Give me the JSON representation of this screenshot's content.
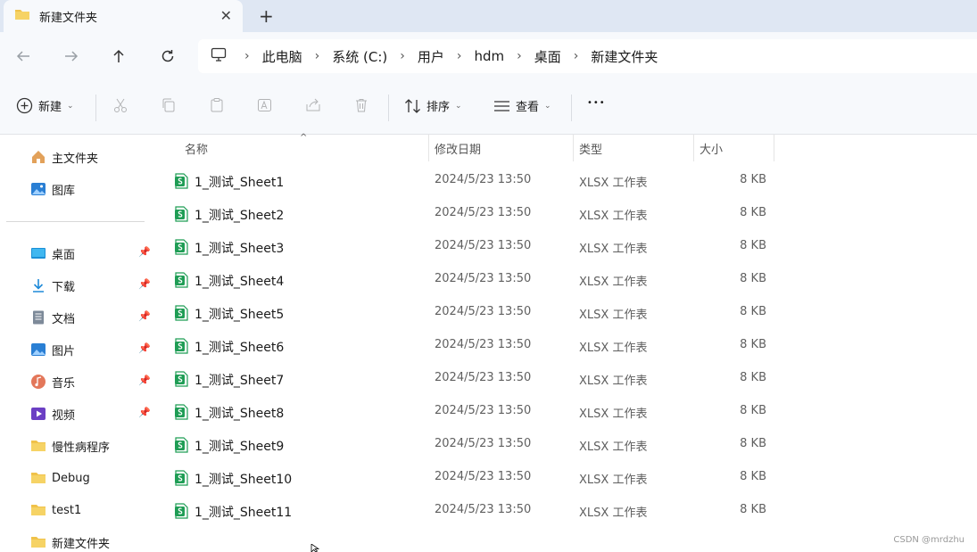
{
  "tab": {
    "title": "新建文件夹",
    "close_glyph": "✕",
    "new_tab_glyph": "+"
  },
  "nav": {
    "back_icon": "arrow-left-icon",
    "forward_icon": "arrow-right-icon",
    "up_icon": "arrow-up-icon",
    "refresh_icon": "refresh-icon"
  },
  "breadcrumb": {
    "sep": "›",
    "items": [
      "此电脑",
      "系统 (C:)",
      "用户",
      "hdm",
      "桌面",
      "新建文件夹"
    ]
  },
  "toolbar": {
    "new_label": "新建",
    "sort_label": "排序",
    "view_label": "查看",
    "more_glyph": "•••",
    "caret": "⌄"
  },
  "sidebar": {
    "items": [
      {
        "label": "主文件夹",
        "icon": "home-icon",
        "pinned": false
      },
      {
        "label": "图库",
        "icon": "gallery-icon",
        "pinned": false
      },
      {
        "label": "桌面",
        "icon": "desktop-icon",
        "pinned": true
      },
      {
        "label": "下载",
        "icon": "download-icon",
        "pinned": true
      },
      {
        "label": "文档",
        "icon": "document-icon",
        "pinned": true
      },
      {
        "label": "图片",
        "icon": "pictures-icon",
        "pinned": true
      },
      {
        "label": "音乐",
        "icon": "music-icon",
        "pinned": true
      },
      {
        "label": "视频",
        "icon": "video-icon",
        "pinned": true
      },
      {
        "label": "慢性病程序",
        "icon": "folder-icon",
        "pinned": false
      },
      {
        "label": "Debug",
        "icon": "folder-icon",
        "pinned": false
      },
      {
        "label": "test1",
        "icon": "folder-icon",
        "pinned": false
      },
      {
        "label": "新建文件夹",
        "icon": "folder-icon",
        "pinned": false
      }
    ]
  },
  "columns": {
    "name": "名称",
    "modified": "修改日期",
    "type": "类型",
    "size": "大小"
  },
  "files": [
    {
      "name": "1_测试_Sheet1",
      "modified": "2024/5/23 13:50",
      "type": "XLSX 工作表",
      "size": "8 KB"
    },
    {
      "name": "1_测试_Sheet2",
      "modified": "2024/5/23 13:50",
      "type": "XLSX 工作表",
      "size": "8 KB"
    },
    {
      "name": "1_测试_Sheet3",
      "modified": "2024/5/23 13:50",
      "type": "XLSX 工作表",
      "size": "8 KB"
    },
    {
      "name": "1_测试_Sheet4",
      "modified": "2024/5/23 13:50",
      "type": "XLSX 工作表",
      "size": "8 KB"
    },
    {
      "name": "1_测试_Sheet5",
      "modified": "2024/5/23 13:50",
      "type": "XLSX 工作表",
      "size": "8 KB"
    },
    {
      "name": "1_测试_Sheet6",
      "modified": "2024/5/23 13:50",
      "type": "XLSX 工作表",
      "size": "8 KB"
    },
    {
      "name": "1_测试_Sheet7",
      "modified": "2024/5/23 13:50",
      "type": "XLSX 工作表",
      "size": "8 KB"
    },
    {
      "name": "1_测试_Sheet8",
      "modified": "2024/5/23 13:50",
      "type": "XLSX 工作表",
      "size": "8 KB"
    },
    {
      "name": "1_测试_Sheet9",
      "modified": "2024/5/23 13:50",
      "type": "XLSX 工作表",
      "size": "8 KB"
    },
    {
      "name": "1_测试_Sheet10",
      "modified": "2024/5/23 13:50",
      "type": "XLSX 工作表",
      "size": "8 KB"
    },
    {
      "name": "1_测试_Sheet11",
      "modified": "2024/5/23 13:50",
      "type": "XLSX 工作表",
      "size": "8 KB"
    }
  ],
  "watermark": "CSDN @mrdzhu",
  "colors": {
    "accent": "#0067c0",
    "tabstrip_bg": "#dfe7f3",
    "chrome_bg": "#f7f9fc",
    "excel_green": "#1f9d55",
    "folder_yellow": "#f0c24a"
  }
}
